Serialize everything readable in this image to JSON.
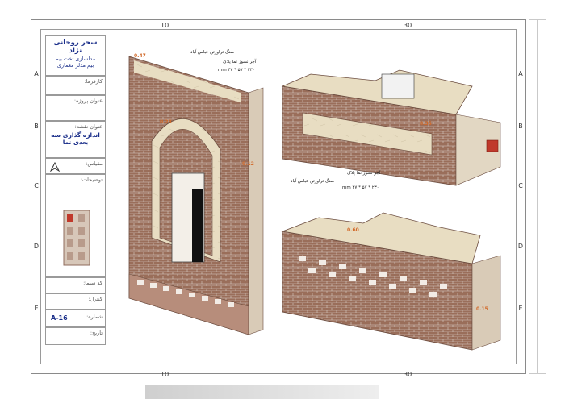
{
  "ruler": {
    "top_numbers": [
      "10",
      "30"
    ],
    "bottom_numbers": [
      "10",
      "30"
    ],
    "left_letters": [
      "A",
      "B",
      "C",
      "D",
      "E"
    ],
    "right_letters": [
      "A",
      "B",
      "C",
      "D",
      "E"
    ]
  },
  "title_block": {
    "author": "سحر روحانی نژاد",
    "subtitle_1": "مدلسازی تخت بیم",
    "subtitle_2": "بیم مدلر معماری",
    "employer_label": "کارفرما:",
    "project_label": "عنوان پروژه:",
    "sheet_title_label": "عنوان نقشه:",
    "sheet_title_line1": "اندازه گذاری سه",
    "sheet_title_line2": "بعدی نما",
    "scale_label": "مقیاس:",
    "key_plan_label": "توضیحات:",
    "drawing_label": "کد سیما:",
    "checked_label": "کنترل:",
    "number_label": "شماره:",
    "sheet_number": "A-16",
    "date_label": "تاریخ:"
  },
  "annotations": {
    "top_left_stone": "سنگ تراورتن عباس آباد",
    "top_left_brick": "آجر نسوز نما پلاک",
    "top_left_dims": "mm ۴۷ * ۵۷ * ۲۳۰",
    "mid_stone": "سنگ تراورتن عباس آباد",
    "mid_brick": "آجر نسوز نما پلاک",
    "mid_dims": "mm ۴۷ * ۵۷ * ۲۳۰"
  },
  "dim_tags": [
    "0.47",
    "0.23",
    "0.12",
    "0.35",
    "0.60",
    "0.15"
  ],
  "colors": {
    "brick": "#9a6e5a",
    "stone": "#e8ddc2",
    "tag": "#d26a2a",
    "title_blue": "#1b2f8a"
  }
}
